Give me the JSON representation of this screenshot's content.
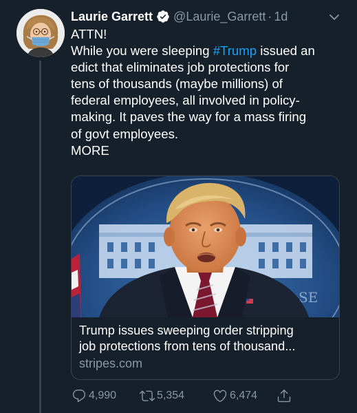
{
  "tweet": {
    "author": {
      "display_name": "Laurie Garrett",
      "handle": "@Laurie_Garrett",
      "verified": true
    },
    "separator": "·",
    "time": "1d",
    "text_lines": [
      "ATTN!",
      "While you were sleeping ",
      "edict that eliminates job protections for",
      "tens of thousands (maybe millions) of",
      "federal employees, all involved in policy-",
      "making. It paves the way for a mass firing",
      "of govt employees.",
      "MORE"
    ],
    "hashtag": "#Trump",
    "after_hashtag": " issued an",
    "card": {
      "title_line_1": "Trump issues sweeping order stripping",
      "title_line_2": "job protections from tens of thousand...",
      "domain": "stripes.com"
    },
    "stats": {
      "replies": "4,990",
      "retweets": "5,354",
      "likes": "6,474"
    }
  },
  "colors": {
    "background": "#15202b",
    "text": "#ffffff",
    "secondary": "#8899a6",
    "link": "#1da1f2",
    "border": "#38444d"
  },
  "icons": {
    "verified": "verified-badge-icon",
    "caret": "chevron-down-icon",
    "reply": "reply-icon",
    "retweet": "retweet-icon",
    "like": "heart-icon",
    "share": "share-icon"
  }
}
